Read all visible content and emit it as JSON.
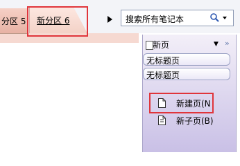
{
  "tabs": [
    {
      "label": "分区 5"
    },
    {
      "label": "新分区 6"
    }
  ],
  "search": {
    "placeholder": "搜索所有笔记本"
  },
  "pages_panel": {
    "new_page_label": "新页",
    "pages": [
      {
        "title": "无标题页"
      },
      {
        "title": "无标题页"
      }
    ]
  },
  "new_page_menu": {
    "items": [
      {
        "label": "新建页(N"
      },
      {
        "label": "新子页(B)"
      }
    ]
  },
  "colors": {
    "highlight": "#e0353b",
    "active_tab": "#fde7e0",
    "panel": "#d9d2ee"
  }
}
